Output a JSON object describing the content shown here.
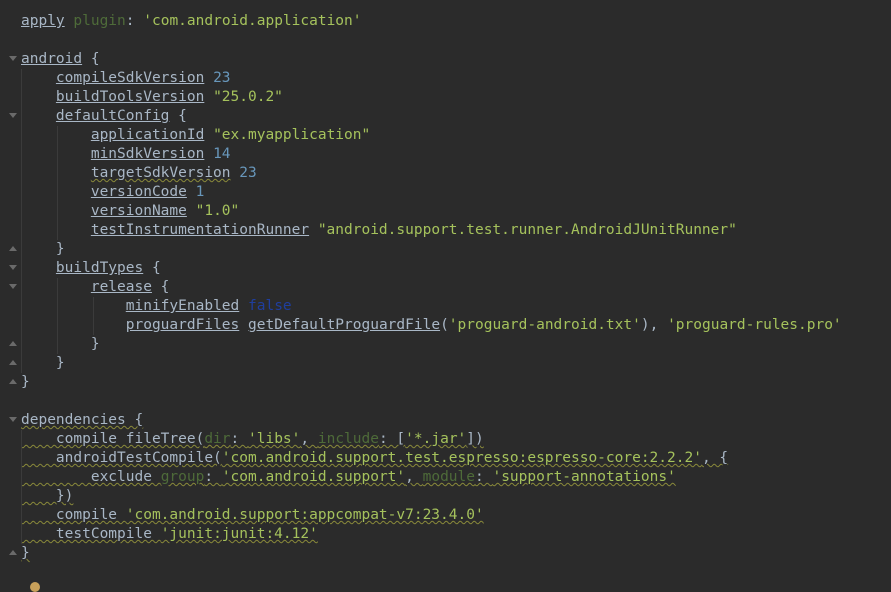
{
  "lines": [
    {
      "parts": [
        {
          "t": "apply",
          "c": "plain u"
        },
        {
          "t": " ",
          "c": "plain"
        },
        {
          "t": "plugin",
          "c": "dim"
        },
        {
          "t": ": ",
          "c": "plain"
        },
        {
          "t": "'com.android.application'",
          "c": "str-b"
        }
      ]
    },
    {
      "parts": []
    },
    {
      "parts": [
        {
          "t": "android",
          "c": "plain u"
        },
        {
          "t": " {",
          "c": "plain"
        }
      ]
    },
    {
      "parts": [
        {
          "t": "    ",
          "c": "plain"
        },
        {
          "t": "compileSdkVersion",
          "c": "plain u"
        },
        {
          "t": " ",
          "c": "plain"
        },
        {
          "t": "23",
          "c": "num"
        }
      ]
    },
    {
      "parts": [
        {
          "t": "    ",
          "c": "plain"
        },
        {
          "t": "buildToolsVersion",
          "c": "plain u"
        },
        {
          "t": " ",
          "c": "plain"
        },
        {
          "t": "\"25.0.2\"",
          "c": "str-b"
        }
      ]
    },
    {
      "parts": [
        {
          "t": "    ",
          "c": "plain"
        },
        {
          "t": "defaultConfig",
          "c": "plain u"
        },
        {
          "t": " {",
          "c": "plain"
        }
      ]
    },
    {
      "parts": [
        {
          "t": "        ",
          "c": "plain"
        },
        {
          "t": "applicationId",
          "c": "plain u"
        },
        {
          "t": " ",
          "c": "plain"
        },
        {
          "t": "\"ex.myapplication\"",
          "c": "str-b"
        }
      ]
    },
    {
      "parts": [
        {
          "t": "        ",
          "c": "plain"
        },
        {
          "t": "minSdkVersion",
          "c": "plain u"
        },
        {
          "t": " ",
          "c": "plain"
        },
        {
          "t": "14",
          "c": "num"
        }
      ]
    },
    {
      "parts": [
        {
          "t": "        ",
          "c": "plain"
        },
        {
          "t": "targetSdkVersion",
          "c": "plain u wavy"
        },
        {
          "t": " ",
          "c": "plain"
        },
        {
          "t": "23",
          "c": "num"
        }
      ]
    },
    {
      "parts": [
        {
          "t": "        ",
          "c": "plain"
        },
        {
          "t": "versionCode",
          "c": "plain u"
        },
        {
          "t": " ",
          "c": "plain"
        },
        {
          "t": "1",
          "c": "num"
        }
      ]
    },
    {
      "parts": [
        {
          "t": "        ",
          "c": "plain"
        },
        {
          "t": "versionName",
          "c": "plain u"
        },
        {
          "t": " ",
          "c": "plain"
        },
        {
          "t": "\"1.0\"",
          "c": "str-b"
        }
      ]
    },
    {
      "parts": [
        {
          "t": "        ",
          "c": "plain"
        },
        {
          "t": "testInstrumentationRunner",
          "c": "plain u"
        },
        {
          "t": " ",
          "c": "plain"
        },
        {
          "t": "\"android.support.test.runner.AndroidJUnitRunner\"",
          "c": "str-b"
        }
      ]
    },
    {
      "parts": [
        {
          "t": "    }",
          "c": "plain"
        }
      ]
    },
    {
      "parts": [
        {
          "t": "    ",
          "c": "plain"
        },
        {
          "t": "buildTypes",
          "c": "plain u"
        },
        {
          "t": " {",
          "c": "plain"
        }
      ]
    },
    {
      "parts": [
        {
          "t": "        ",
          "c": "plain"
        },
        {
          "t": "release",
          "c": "plain u"
        },
        {
          "t": " {",
          "c": "plain"
        }
      ]
    },
    {
      "parts": [
        {
          "t": "            ",
          "c": "plain"
        },
        {
          "t": "minifyEnabled",
          "c": "plain u"
        },
        {
          "t": " ",
          "c": "plain"
        },
        {
          "t": "false",
          "c": "kw-dark"
        }
      ]
    },
    {
      "parts": [
        {
          "t": "            ",
          "c": "plain"
        },
        {
          "t": "proguardFiles",
          "c": "plain u"
        },
        {
          "t": " ",
          "c": "plain"
        },
        {
          "t": "getDefaultProguardFile",
          "c": "plain u"
        },
        {
          "t": "(",
          "c": "plain"
        },
        {
          "t": "'proguard-android.txt'",
          "c": "str-b"
        },
        {
          "t": "), ",
          "c": "plain"
        },
        {
          "t": "'proguard-rules.pro'",
          "c": "str-b"
        }
      ]
    },
    {
      "parts": [
        {
          "t": "        }",
          "c": "plain"
        }
      ]
    },
    {
      "parts": [
        {
          "t": "    }",
          "c": "plain"
        }
      ]
    },
    {
      "parts": [
        {
          "t": "}",
          "c": "plain"
        }
      ]
    },
    {
      "parts": []
    },
    {
      "parts": [
        {
          "t": "dependencies {",
          "c": "plain wavy"
        }
      ]
    },
    {
      "parts": [
        {
          "t": "    compile fileTree(",
          "c": "plain wavy"
        },
        {
          "t": "dir",
          "c": "dim wavy"
        },
        {
          "t": ": ",
          "c": "plain wavy"
        },
        {
          "t": "'libs'",
          "c": "str-b wavy"
        },
        {
          "t": ", ",
          "c": "plain wavy"
        },
        {
          "t": "include",
          "c": "dim wavy"
        },
        {
          "t": ": [",
          "c": "plain wavy"
        },
        {
          "t": "'*.jar'",
          "c": "str-b wavy"
        },
        {
          "t": "])",
          "c": "plain wavy"
        }
      ]
    },
    {
      "parts": [
        {
          "t": "    androidTestCompile(",
          "c": "plain wavy"
        },
        {
          "t": "'com.android.support.test.espresso:espresso-core:2.2.2'",
          "c": "str-b wavy"
        },
        {
          "t": ", {",
          "c": "plain wavy"
        }
      ]
    },
    {
      "parts": [
        {
          "t": "        exclude ",
          "c": "plain wavy"
        },
        {
          "t": "group",
          "c": "dim wavy"
        },
        {
          "t": ": ",
          "c": "plain wavy"
        },
        {
          "t": "'com.android.support'",
          "c": "str-b wavy"
        },
        {
          "t": ", ",
          "c": "plain wavy"
        },
        {
          "t": "module",
          "c": "dim wavy"
        },
        {
          "t": ": ",
          "c": "plain wavy"
        },
        {
          "t": "'support-annotations'",
          "c": "str-b wavy"
        }
      ]
    },
    {
      "parts": [
        {
          "t": "    })",
          "c": "plain wavy"
        }
      ]
    },
    {
      "parts": [
        {
          "t": "    compile ",
          "c": "plain wavy"
        },
        {
          "t": "'com.android.support:appcompat-v7:23.4.0'",
          "c": "str-b wavy"
        }
      ]
    },
    {
      "parts": [
        {
          "t": "    testCompile ",
          "c": "plain wavy"
        },
        {
          "t": "'junit:junit:4.12'",
          "c": "str-b wavy"
        }
      ]
    },
    {
      "parts": [
        {
          "t": "}",
          "c": "plain wavy"
        }
      ]
    }
  ],
  "colors": {
    "background": "#2b2b2b",
    "text": "#a9b7c6",
    "string": "#a5c25c",
    "number": "#6897bb",
    "keyword_false": "#1f3e9e",
    "named_arg": "#4e6b39"
  }
}
